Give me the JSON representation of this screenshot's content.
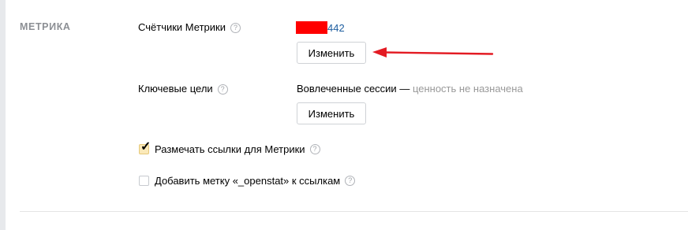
{
  "section": {
    "title": "МЕТРИКА"
  },
  "counters": {
    "label": "Счётчики Метрики",
    "help_icon": "?",
    "counter_suffix": "442",
    "change_label": "Изменить"
  },
  "goals": {
    "label": "Ключевые цели",
    "help_icon": "?",
    "goal_name": "Вовлеченные сессии",
    "separator": " — ",
    "goal_status": "ценность не назначена",
    "change_label": "Изменить"
  },
  "options": [
    {
      "label": "Размечать ссылки для Метрики",
      "checked": true,
      "help_icon": "?"
    },
    {
      "label": "Добавить метку «_openstat» к ссылкам",
      "checked": false,
      "help_icon": "?"
    }
  ],
  "colors": {
    "link": "#1f5fa0",
    "redaction": "#ff0000",
    "arrow": "#e31b23",
    "muted": "#999999"
  }
}
